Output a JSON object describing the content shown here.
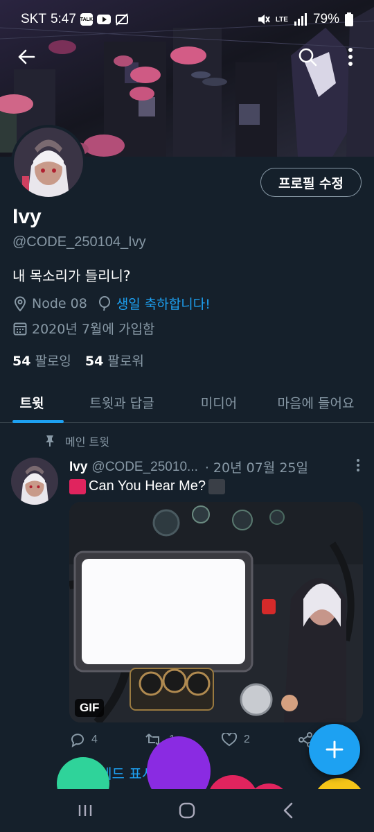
{
  "status_bar": {
    "carrier": "SKT",
    "time": "5:47",
    "talk_badge": "TALK",
    "battery": "79%",
    "network": "LTE"
  },
  "profile": {
    "name": "Ivy",
    "handle": "@CODE_250104_Ivy",
    "bio": "내 목소리가 들리니?",
    "location": "Node 08",
    "birthday_text": "생일 축하합니다!",
    "joined": "2020년 7월에 가입함",
    "following_count": "54",
    "following_label": "팔로잉",
    "followers_count": "54",
    "followers_label": "팔로워",
    "edit_button": "프로필 수정"
  },
  "tabs": [
    {
      "label": "트윗"
    },
    {
      "label": "트윗과 답글"
    },
    {
      "label": "미디어"
    },
    {
      "label": "마음에 들어요"
    }
  ],
  "pinned_label": "메인 트윗",
  "tweet": {
    "name": "Ivy",
    "handle": "@CODE_25010...",
    "date": "· 20년 07월 25일",
    "text": "Can You Hear Me?",
    "gif_label": "GIF",
    "reply_count": "4",
    "retweet_count": "1",
    "like_count": "2",
    "thread_link": "이 스레드 표시"
  },
  "colors": {
    "background": "#15202b",
    "accent": "#1da1f2",
    "muted": "#8899a6",
    "red_square": "#e0245e",
    "dark_square": "#3a3f47"
  }
}
